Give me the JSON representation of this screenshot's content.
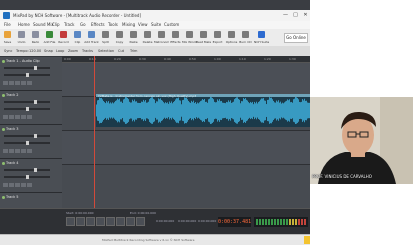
{
  "window": {
    "title": "MixPad by NCH Software - [Multitrack Audio Recorder - Untitled]",
    "controls": [
      "—",
      "□",
      "✕"
    ]
  },
  "menu": [
    "File",
    "Home",
    "Sound Mix",
    "Clip",
    "Track",
    "Go",
    "Effects",
    "Tools",
    "Mixing",
    "View",
    "Suite",
    "Custom"
  ],
  "toolbar": {
    "buttons": [
      {
        "label": "Save",
        "color": "#e8a23a"
      },
      {
        "label": "Undo",
        "color": "#8a8fa0"
      },
      {
        "label": "Redo",
        "color": "#8a8fa0"
      },
      {
        "label": "Add File",
        "color": "#3a8a3a"
      },
      {
        "label": "Record",
        "color": "#c43c3c"
      },
      {
        "label": "Clip",
        "color": "#5a87c4"
      },
      {
        "label": "Add Track",
        "color": "#5a87c4"
      },
      {
        "label": "Split",
        "color": "#7a7a7a"
      },
      {
        "label": "Copy",
        "color": "#7a7a7a"
      },
      {
        "label": "Paste",
        "color": "#7a7a7a"
      },
      {
        "label": "Delete",
        "color": "#7a7a7a"
      },
      {
        "label": "Metronome",
        "color": "#7a7a7a"
      },
      {
        "label": "Effects",
        "color": "#7a7a7a"
      },
      {
        "label": "Mix Window",
        "color": "#7a7a7a"
      },
      {
        "label": "Beat Maker",
        "color": "#7a7a7a"
      },
      {
        "label": "Export",
        "color": "#7a7a7a"
      },
      {
        "label": "Options",
        "color": "#7a7a7a"
      },
      {
        "label": "Burn CD",
        "color": "#7a7a7a"
      },
      {
        "label": "NCH Suite",
        "color": "#2e6bd0"
      }
    ],
    "go_online": "Go Online"
  },
  "subtoolbar": [
    "Sync",
    "Tempo:",
    "120.00",
    "Snap",
    "Loop",
    "Zoom",
    "Tracks",
    "Selection",
    "Cut",
    "Trim"
  ],
  "ruler": {
    "ticks": [
      "0:00",
      "0:10",
      "0:20",
      "0:30",
      "0:40",
      "0:50",
      "1:00",
      "1:10",
      "1:20",
      "1:30"
    ]
  },
  "tracks": [
    {
      "name": "Track 1 - Audio Clip",
      "active": false
    },
    {
      "name": "Track 2",
      "active": true
    },
    {
      "name": "Track 3",
      "active": false
    },
    {
      "name": "Track 4",
      "active": false
    },
    {
      "name": "Track 5",
      "active": false
    }
  ],
  "clip": {
    "label": "Y2Mate.is - Instrumental from cancion sin voz (High Quality).mp3"
  },
  "bottom": {
    "start_label": "Start: 0:00:00.000",
    "end_label": "End: 0:00:00.000",
    "sel_start": "0:00:00.000",
    "sel_end": "0:00:00.000",
    "len": "0:00:00.000",
    "current_time": "0:00:37.481"
  },
  "statusbar": {
    "text": "MixPad Multitrack Recording Software v 6.xx © NCH Software"
  },
  "webcam": {
    "caption": "PROF. VINICIUS DE CARVALHO"
  }
}
